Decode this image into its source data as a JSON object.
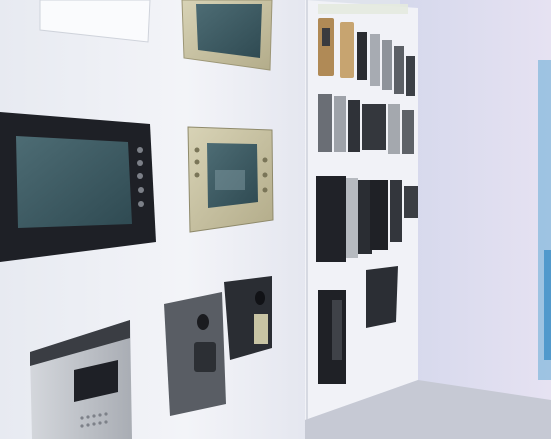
{
  "scene": {
    "description_label": "",
    "header_sign_text": "",
    "colors": {
      "wall": "#eef0f5",
      "wall_shadow": "#c9ced9",
      "right_wall": "#d8dbee",
      "panel_white": "#f7f8fb",
      "device_black": "#1d1f24",
      "device_dark": "#2a2d33",
      "screen_teal": "#3f5e66",
      "gold_frame": "#c9c3a4",
      "silver": "#b9bdc4",
      "blue_glow": "#6aa9d8",
      "floor": "#c8cbd6"
    }
  }
}
